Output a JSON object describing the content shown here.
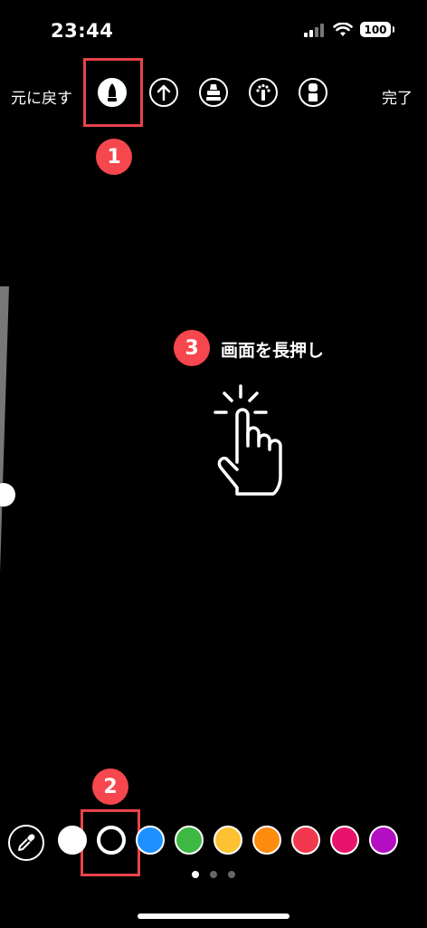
{
  "status": {
    "time": "23:44",
    "battery": "100"
  },
  "toolbar": {
    "undo_label": "元に戻す",
    "done_label": "完了",
    "tools": [
      {
        "name": "pen-tool",
        "selected": true
      },
      {
        "name": "arrow-tool",
        "selected": false
      },
      {
        "name": "marker-tool",
        "selected": false
      },
      {
        "name": "neon-tool",
        "selected": false
      },
      {
        "name": "eraser-tool",
        "selected": false
      }
    ]
  },
  "annotations": {
    "step1": "1",
    "step2": "2",
    "step3": "3",
    "instruction": "画面を長押し",
    "highlight_color": "#e8434a"
  },
  "palette": {
    "colors": [
      "#ffffff",
      "#000000",
      "#1e90ff",
      "#3cb843",
      "#fcc233",
      "#fc8c0e",
      "#f2384e",
      "#e8146c",
      "#b30ec2"
    ],
    "selected_index": 1
  },
  "pagination": {
    "pages": 3,
    "active": 0
  }
}
